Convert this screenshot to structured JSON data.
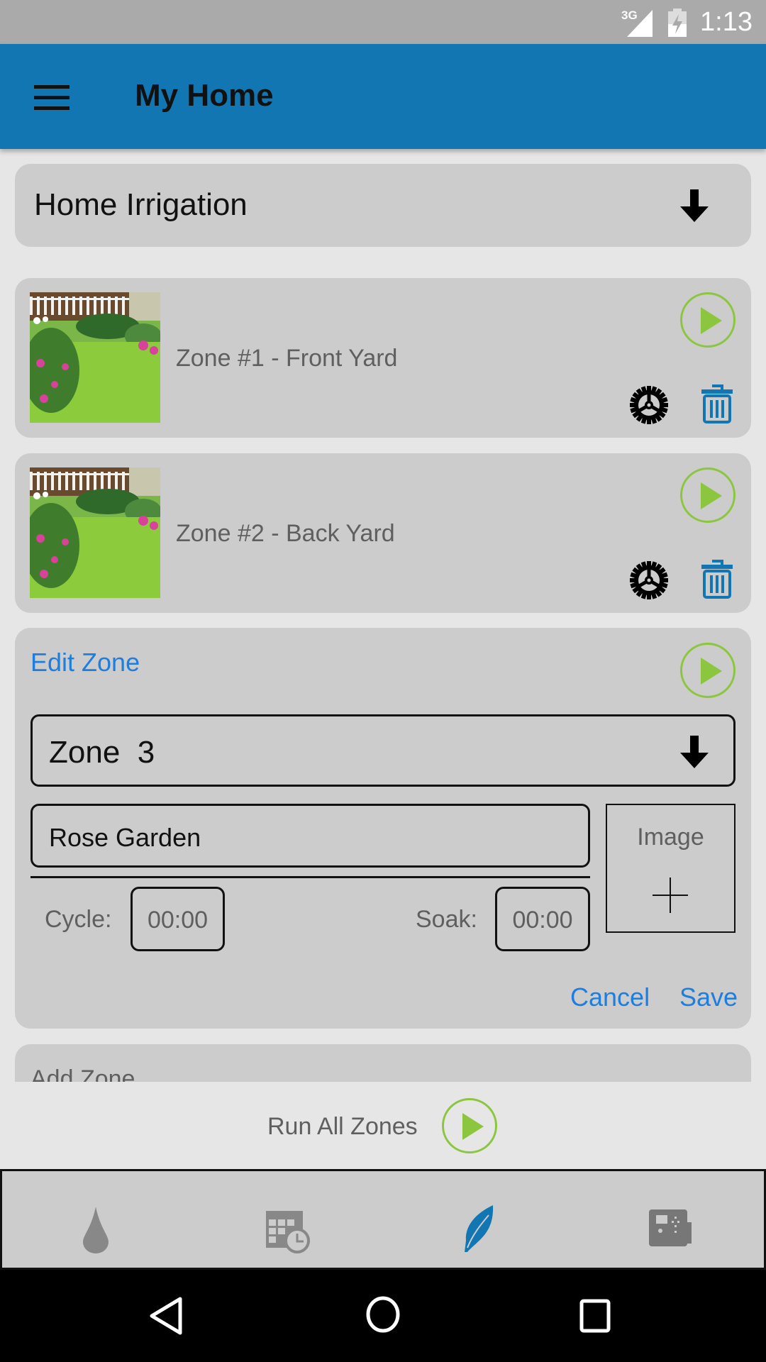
{
  "status_bar": {
    "network": "3G",
    "time": "1:13"
  },
  "app_bar": {
    "title": "My Home",
    "menu_icon": "hamburger-icon"
  },
  "controller_select": {
    "value": "Home Irrigation",
    "icon": "arrow-down-icon"
  },
  "zones": [
    {
      "name": "Zone #1 - Front Yard"
    },
    {
      "name": "Zone #2 - Back Yard"
    }
  ],
  "edit_zone": {
    "heading": "Edit Zone",
    "zone_select": "Zone  3",
    "name_value": "Rose Garden",
    "image_label": "Image",
    "cycle_label": "Cycle:",
    "cycle_value": "00:00",
    "soak_label": "Soak:",
    "soak_value": "00:00",
    "cancel": "Cancel",
    "save": "Save"
  },
  "add_zone": "Add Zone",
  "run_all": "Run All Zones",
  "bottom_nav": [
    {
      "icon": "water-drop-icon"
    },
    {
      "icon": "calendar-clock-icon"
    },
    {
      "icon": "leaf-icon",
      "active": true
    },
    {
      "icon": "controller-icon"
    }
  ],
  "colors": {
    "app_bar": "#1276b3",
    "play": "#8cc63f",
    "link": "#1d7ee0",
    "active": "#1276b3"
  }
}
